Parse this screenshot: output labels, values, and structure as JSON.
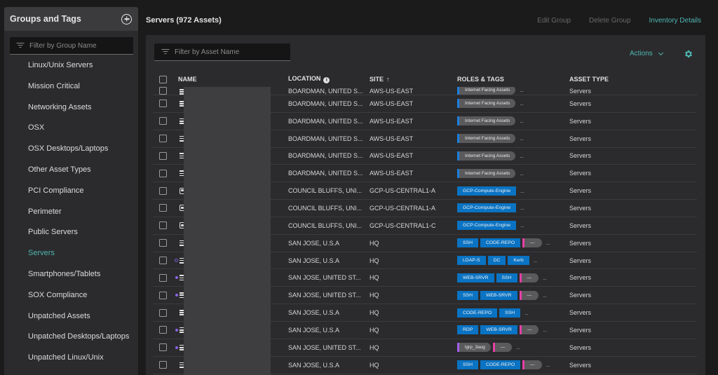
{
  "sidebar": {
    "title": "Groups and Tags",
    "add_icon": "plus-circle-icon",
    "filter_placeholder": "Filter by Group Name",
    "items": [
      {
        "label": "Linux/Unix Servers",
        "active": false
      },
      {
        "label": "Mission Critical",
        "active": false
      },
      {
        "label": "Networking Assets",
        "active": false
      },
      {
        "label": "OSX",
        "active": false
      },
      {
        "label": "OSX Desktops/Laptops",
        "active": false
      },
      {
        "label": "Other Asset Types",
        "active": false
      },
      {
        "label": "PCI Compliance",
        "active": false
      },
      {
        "label": "Perimeter",
        "active": false
      },
      {
        "label": "Public Servers",
        "active": false
      },
      {
        "label": "Servers",
        "active": true
      },
      {
        "label": "Smartphones/Tablets",
        "active": false
      },
      {
        "label": "SOX Compliance",
        "active": false
      },
      {
        "label": "Unpatched Assets",
        "active": false
      },
      {
        "label": "Unpatched Desktops/Laptops",
        "active": false
      },
      {
        "label": "Unpatched Linux/Unix",
        "active": false
      }
    ]
  },
  "header": {
    "title": "Servers (972 Assets)",
    "edit_group": "Edit Group",
    "delete_group": "Delete Group",
    "inventory_details": "Inventory Details"
  },
  "panel": {
    "filter_placeholder": "Filter by Asset Name",
    "actions_label": "Actions",
    "settings_icon": "gear-icon"
  },
  "colors": {
    "accent": "#4fb6b0",
    "tag_blue": "#0a73c3",
    "bar_blue": "#1a7fe0",
    "bar_pink": "#e83fa6",
    "bar_purple": "#a45ce8",
    "agent_dot": "#8a63e8"
  },
  "table": {
    "columns": {
      "name": "NAME",
      "location": "LOCATION",
      "location_info": "i",
      "site": "SITE",
      "site_sort": "↑",
      "roles": "ROLES & TAGS",
      "asset_type": "ASSET TYPE"
    },
    "more": "...",
    "rows": [
      {
        "icon": "server",
        "dot": "none",
        "location": "BOARDMAN, UNITED S...",
        "site": "AWS-US-EAST",
        "tags": [],
        "pills": [
          {
            "label": "Internet Facing Assets",
            "color": "blue"
          }
        ],
        "asset_type": "Servers",
        "partial": true
      },
      {
        "icon": "server",
        "dot": "none",
        "location": "BOARDMAN, UNITED S...",
        "site": "AWS-US-EAST",
        "tags": [],
        "pills": [
          {
            "label": "Internet Facing Assets",
            "color": "blue"
          }
        ],
        "asset_type": "Servers"
      },
      {
        "icon": "server",
        "dot": "none",
        "location": "BOARDMAN, UNITED S...",
        "site": "AWS-US-EAST",
        "tags": [],
        "pills": [
          {
            "label": "Internet Facing Assets",
            "color": "blue"
          }
        ],
        "asset_type": "Servers"
      },
      {
        "icon": "server",
        "dot": "none",
        "location": "BOARDMAN, UNITED S...",
        "site": "AWS-US-EAST",
        "tags": [],
        "pills": [
          {
            "label": "Internet Facing Assets",
            "color": "blue"
          }
        ],
        "asset_type": "Servers"
      },
      {
        "icon": "server",
        "dot": "none",
        "location": "BOARDMAN, UNITED S...",
        "site": "AWS-US-EAST",
        "tags": [],
        "pills": [
          {
            "label": "Internet Facing Assets",
            "color": "blue"
          }
        ],
        "asset_type": "Servers"
      },
      {
        "icon": "server",
        "dot": "none",
        "location": "BOARDMAN, UNITED S...",
        "site": "AWS-US-EAST",
        "tags": [],
        "pills": [
          {
            "label": "Internet Facing Assets",
            "color": "blue"
          }
        ],
        "asset_type": "Servers"
      },
      {
        "icon": "cloud",
        "dot": "none",
        "location": "COUNCIL BLUFFS, UNI...",
        "site": "GCP-US-CENTRAL1-A",
        "tags": [
          "GCP-Compute-Engine"
        ],
        "pills": [],
        "asset_type": "Servers"
      },
      {
        "icon": "cloud",
        "dot": "none",
        "location": "COUNCIL BLUFFS, UNI...",
        "site": "GCP-US-CENTRAL1-A",
        "tags": [
          "GCP-Compute-Engine"
        ],
        "pills": [],
        "asset_type": "Servers"
      },
      {
        "icon": "cloud",
        "dot": "none",
        "location": "COUNCIL BLUFFS, UNI...",
        "site": "GCP-US-CENTRAL1-C",
        "tags": [
          "GCP-Compute-Engine"
        ],
        "pills": [],
        "asset_type": "Servers"
      },
      {
        "icon": "server",
        "dot": "none",
        "location": "SAN JOSE, U.S.A",
        "site": "HQ",
        "tags": [
          "SSH",
          "CODE-REPO"
        ],
        "pills": [
          {
            "label": "—",
            "color": "pink"
          }
        ],
        "asset_type": "Servers"
      },
      {
        "icon": "server",
        "dot": "hollow",
        "location": "SAN JOSE, U.S.A",
        "site": "HQ",
        "tags": [
          "LDAP-S",
          "DC",
          "Kerb"
        ],
        "pills": [],
        "asset_type": "Servers"
      },
      {
        "icon": "server",
        "dot": "filled",
        "location": "SAN JOSE, UNITED ST...",
        "site": "HQ",
        "tags": [
          "WEB-SRVR",
          "SSH"
        ],
        "pills": [
          {
            "label": "—",
            "color": "pink"
          }
        ],
        "asset_type": "Servers"
      },
      {
        "icon": "server",
        "dot": "filled",
        "location": "SAN JOSE, UNITED ST...",
        "site": "HQ",
        "tags": [
          "SSH",
          "WEB-SRVR"
        ],
        "pills": [
          {
            "label": "—",
            "color": "pink"
          }
        ],
        "asset_type": "Servers"
      },
      {
        "icon": "server",
        "dot": "none",
        "location": "SAN JOSE, U.S.A",
        "site": "HQ",
        "tags": [
          "CODE-REPO",
          "SSH"
        ],
        "pills": [],
        "asset_type": "Servers"
      },
      {
        "icon": "server",
        "dot": "filled",
        "location": "SAN JOSE, U.S.A",
        "site": "HQ",
        "tags": [
          "RDP",
          "WEB-SRVR"
        ],
        "pills": [
          {
            "label": "—",
            "color": "pink"
          }
        ],
        "asset_type": "Servers"
      },
      {
        "icon": "server",
        "dot": "filled",
        "location": "SAN JOSE, UNITED ST...",
        "site": "HQ",
        "tags": [],
        "pills": [
          {
            "label": "lgrp_3aug",
            "color": "purple"
          },
          {
            "label": "—",
            "color": "pink"
          }
        ],
        "asset_type": "Servers"
      },
      {
        "icon": "server",
        "dot": "none",
        "location": "SAN JOSE, U.S.A",
        "site": "HQ",
        "tags": [
          "SSH",
          "CODE-REPO"
        ],
        "pills": [
          {
            "label": "—",
            "color": "pink"
          }
        ],
        "asset_type": "Servers"
      }
    ]
  }
}
